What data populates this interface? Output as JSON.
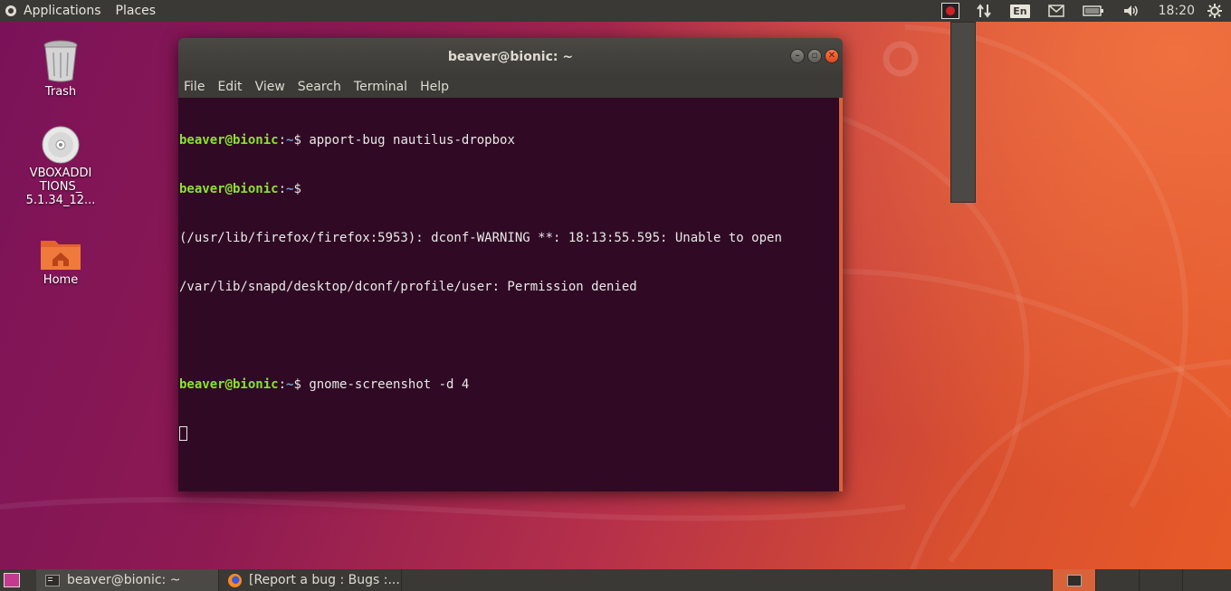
{
  "top_panel": {
    "applications_label": "Applications",
    "places_label": "Places",
    "keyboard_layout": "En",
    "clock": "18:20",
    "icons": [
      "record-icon",
      "network-icon",
      "keyboard-layout-icon",
      "mail-icon",
      "battery-icon",
      "volume-icon",
      "settings-gear-icon"
    ]
  },
  "desktop": {
    "icons": [
      {
        "name": "trash",
        "label": "Trash",
        "icon": "trash-icon"
      },
      {
        "name": "vbox",
        "label_lines": [
          "VBOXADDI",
          "TIONS_",
          "5.1.34_12..."
        ],
        "icon": "disc-icon"
      },
      {
        "name": "home",
        "label": "Home",
        "icon": "home-folder-icon"
      }
    ]
  },
  "terminal": {
    "title": "beaver@bionic: ~",
    "menu": [
      "File",
      "Edit",
      "View",
      "Search",
      "Terminal",
      "Help"
    ],
    "prompt_user": "beaver@bionic",
    "prompt_sep": ":",
    "prompt_path": "~",
    "prompt_end": "$ ",
    "lines": [
      {
        "type": "prompt",
        "command": "apport-bug nautilus-dropbox"
      },
      {
        "type": "prompt",
        "command": ""
      },
      {
        "type": "output",
        "text": "(/usr/lib/firefox/firefox:5953): dconf-WARNING **: 18:13:55.595: Unable to open"
      },
      {
        "type": "output",
        "text": "/var/lib/snapd/desktop/dconf/profile/user: Permission denied"
      },
      {
        "type": "output",
        "text": ""
      },
      {
        "type": "prompt",
        "command": "gnome-screenshot -d 4"
      }
    ]
  },
  "bottom_panel": {
    "tasks": [
      {
        "label": "beaver@bionic: ~",
        "icon": "terminal-icon",
        "active": true
      },
      {
        "label": "[Report a bug : Bugs :...",
        "icon": "firefox-icon",
        "active": false
      }
    ]
  },
  "colors": {
    "prompt_user": "#8ae234",
    "prompt_path": "#729fcf",
    "terminal_bg": "#300a24",
    "panel_bg": "#3a3935",
    "accent": "#d8623a"
  }
}
